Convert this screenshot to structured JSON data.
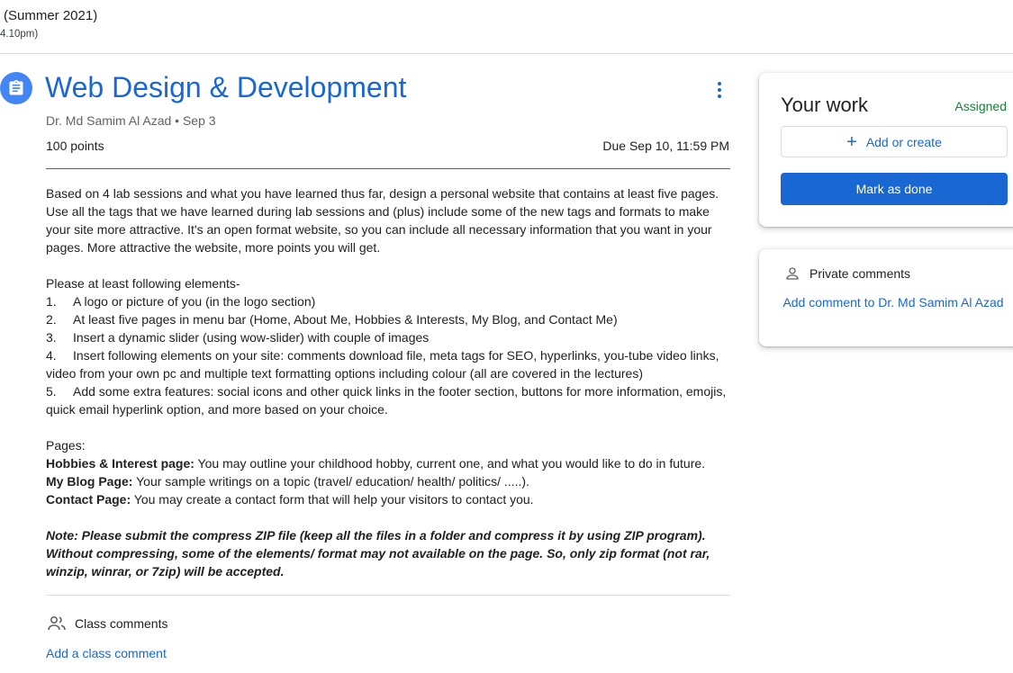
{
  "header": {
    "course_name": "(Summer 2021)",
    "course_time": "4.10pm)"
  },
  "assignment": {
    "title": "Web Design & Development",
    "author": "Dr. Md Samim Al Azad",
    "date": "Sep 3",
    "meta_sep": " • ",
    "points": "100 points",
    "due": "Due Sep 10, 11:59 PM",
    "description": {
      "intro": "Based on 4 lab sessions and what you have learned thus far, design a personal website that contains at least five pages. Use all the tags that we have learned during lab sessions and (plus) include some of the new tags and formats to make your site more attractive. It's an open format website, so you can include all necessary information that you want in your pages. More attractive the website, more points you will get.",
      "elements_heading": "Please at least following elements-",
      "elements": [
        {
          "num": "1.",
          "text": "A logo or picture of you (in the logo section)"
        },
        {
          "num": "2.",
          "text": "At least five pages in menu bar (Home, About Me, Hobbies & Interests, My Blog, and Contact Me)"
        },
        {
          "num": "3.",
          "text": "Insert a dynamic slider (using wow-slider) with couple of images"
        },
        {
          "num": "4.",
          "text": "Insert following elements on your site: comments download file, meta tags for SEO, hyperlinks, you-tube video links, video from your own pc and multiple text formatting options including colour (all are covered in the lectures)"
        },
        {
          "num": "5.",
          "text": "Add some extra features: social icons and other quick links in the footer section, buttons for more information, emojis, quick email hyperlink option, and more based on your choice."
        }
      ],
      "pages_heading": "Pages:",
      "pages": [
        {
          "label": "Hobbies & Interest page:",
          "text": " You may outline your childhood hobby, current one, and what you would like to do in future."
        },
        {
          "label": "My Blog Page:",
          "text": " Your sample writings on a topic (travel/ education/ health/ politics/ .....)."
        },
        {
          "label": "Contact Page:",
          "text": " You may create a contact form that will help your visitors to contact you."
        }
      ],
      "note": "Note: Please submit the compress ZIP file (keep all the files in a folder and compress it by using ZIP program). Without compressing, some of the elements/ format may not available on the page. So, only zip format (not rar, winzip, winrar, or 7zip) will be accepted."
    },
    "class_comments_label": "Class comments",
    "add_class_comment": "Add a class comment"
  },
  "your_work": {
    "title": "Your work",
    "status": "Assigned",
    "status_color": "#188038",
    "add_create_label": "Add or create",
    "mark_done_label": "Mark as done"
  },
  "private_comments": {
    "label": "Private comments",
    "add_label": "Add comment to Dr. Md Samim Al Azad"
  },
  "colors": {
    "accent": "#1967d2",
    "icon_circle": "#4285f4"
  }
}
